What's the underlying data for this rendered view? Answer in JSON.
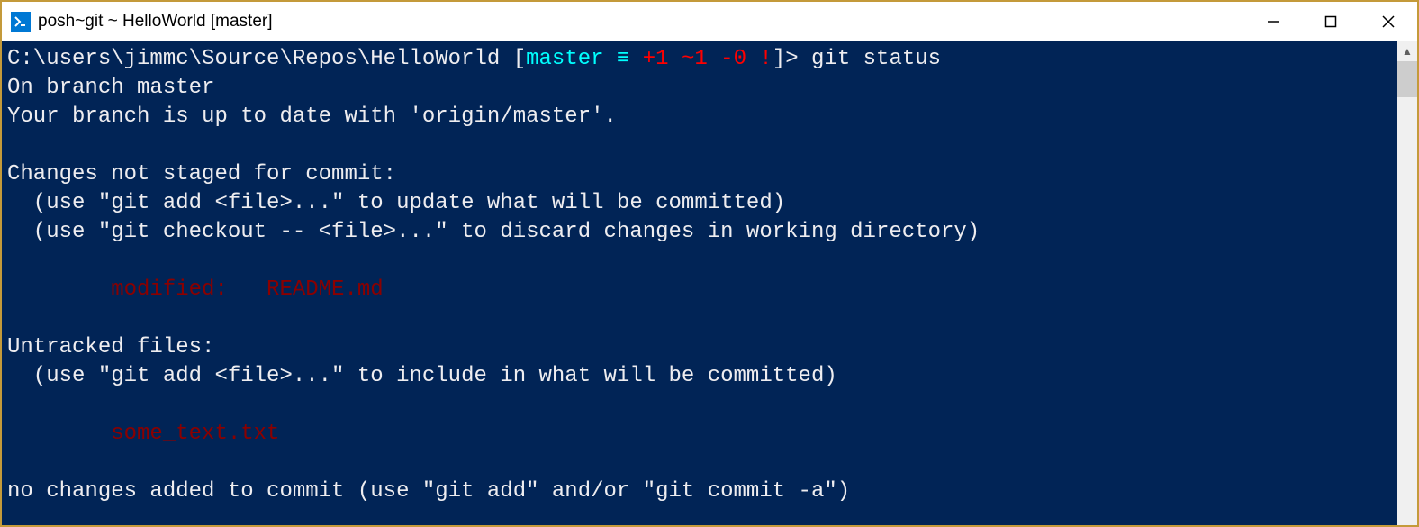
{
  "titlebar": {
    "title": "posh~git ~ HelloWorld [master]"
  },
  "prompt": {
    "path": "C:\\users\\jimmc\\Source\\Repos\\HelloWorld",
    "bracket_open": " [",
    "branch": "master",
    "equiv": " ≡",
    "plus": " +1",
    "tilde": " ~1",
    "minus": " -0",
    "bang": " !",
    "bracket_close": "]>",
    "command": " git status"
  },
  "output": {
    "l1": "On branch master",
    "l2": "Your branch is up to date with 'origin/master'.",
    "l3": "",
    "l4": "Changes not staged for commit:",
    "l5": "  (use \"git add <file>...\" to update what will be committed)",
    "l6": "  (use \"git checkout -- <file>...\" to discard changes in working directory)",
    "l7": "",
    "l8": "        modified:   README.md",
    "l9": "",
    "l10": "Untracked files:",
    "l11": "  (use \"git add <file>...\" to include in what will be committed)",
    "l12": "",
    "l13": "        some_text.txt",
    "l14": "",
    "l15": "no changes added to commit (use \"git add\" and/or \"git commit -a\")"
  }
}
